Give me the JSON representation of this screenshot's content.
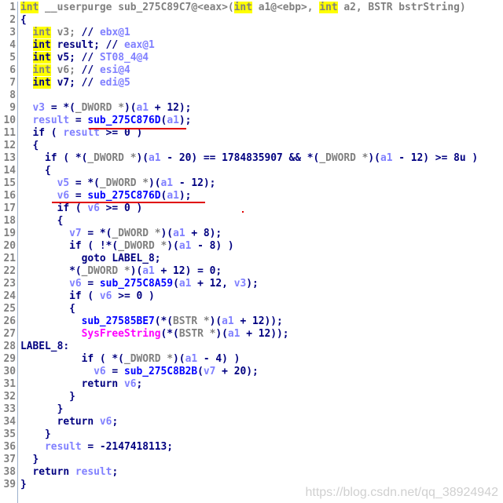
{
  "colors": {
    "keyword": "#000080",
    "type_decl": "#808080",
    "variable": "#8080ff",
    "function": "#0000ff",
    "import": "#ff00ff",
    "highlight": "#ffff00",
    "annotation": "#e00000"
  },
  "lines": [
    [
      [
        "yg",
        "int"
      ],
      [
        "g",
        " __userpurge sub_275C89C7@<eax>("
      ],
      [
        "yg",
        "int"
      ],
      [
        "g",
        " a1@<ebp>, "
      ],
      [
        "yg",
        "int"
      ],
      [
        "g",
        " a2, BSTR bstrString)"
      ]
    ],
    [
      [
        "k",
        "{"
      ]
    ],
    [
      [
        "k",
        "  "
      ],
      [
        "yg",
        "int"
      ],
      [
        "g",
        " v3; "
      ],
      [
        "k",
        "// "
      ],
      [
        "v",
        "ebx@1"
      ]
    ],
    [
      [
        "k",
        "  "
      ],
      [
        "yk",
        "int"
      ],
      [
        "k",
        " result; // "
      ],
      [
        "v",
        "eax@1"
      ]
    ],
    [
      [
        "k",
        "  "
      ],
      [
        "yk",
        "int"
      ],
      [
        "k",
        " v5; // "
      ],
      [
        "v",
        "ST08_4@4"
      ]
    ],
    [
      [
        "k",
        "  "
      ],
      [
        "yg",
        "int"
      ],
      [
        "g",
        " v6; "
      ],
      [
        "k",
        "// "
      ],
      [
        "v",
        "esi@4"
      ]
    ],
    [
      [
        "k",
        "  "
      ],
      [
        "yk",
        "int"
      ],
      [
        "k",
        " v7; // "
      ],
      [
        "v",
        "edi@5"
      ]
    ],
    [],
    [
      [
        "k",
        "  "
      ],
      [
        "v",
        "v3"
      ],
      [
        "k",
        " = *("
      ],
      [
        "g",
        "_DWORD *"
      ],
      [
        "k",
        ")("
      ],
      [
        "v",
        "a1"
      ],
      [
        "k",
        " + 12);"
      ]
    ],
    [
      [
        "k",
        "  "
      ],
      [
        "v",
        "result"
      ],
      [
        "k",
        " = "
      ],
      [
        "f",
        "sub_275C876D"
      ],
      [
        "k",
        "("
      ],
      [
        "v",
        "a1"
      ],
      [
        "k",
        ");"
      ]
    ],
    [
      [
        "k",
        "  if ( "
      ],
      [
        "v",
        "result"
      ],
      [
        "k",
        " >= 0 )"
      ]
    ],
    [
      [
        "k",
        "  {"
      ]
    ],
    [
      [
        "k",
        "    if ( *("
      ],
      [
        "g",
        "_DWORD *"
      ],
      [
        "k",
        ")("
      ],
      [
        "v",
        "a1"
      ],
      [
        "k",
        " - 20) == 1784835907 && *("
      ],
      [
        "g",
        "_DWORD *"
      ],
      [
        "k",
        ")("
      ],
      [
        "v",
        "a1"
      ],
      [
        "k",
        " - 12) >= 8u )"
      ]
    ],
    [
      [
        "k",
        "    {"
      ]
    ],
    [
      [
        "k",
        "      "
      ],
      [
        "v",
        "v5"
      ],
      [
        "k",
        " = *("
      ],
      [
        "g",
        "_DWORD *"
      ],
      [
        "k",
        ")("
      ],
      [
        "v",
        "a1"
      ],
      [
        "k",
        " - 12);"
      ]
    ],
    [
      [
        "k",
        "      "
      ],
      [
        "v",
        "v6"
      ],
      [
        "k",
        " = "
      ],
      [
        "f",
        "sub_275C876D"
      ],
      [
        "k",
        "("
      ],
      [
        "v",
        "a1"
      ],
      [
        "k",
        ");"
      ]
    ],
    [
      [
        "k",
        "      if ( "
      ],
      [
        "v",
        "v6"
      ],
      [
        "k",
        " >= 0 )"
      ]
    ],
    [
      [
        "k",
        "      {"
      ]
    ],
    [
      [
        "k",
        "        "
      ],
      [
        "v",
        "v7"
      ],
      [
        "k",
        " = *("
      ],
      [
        "g",
        "_DWORD *"
      ],
      [
        "k",
        ")("
      ],
      [
        "v",
        "a1"
      ],
      [
        "k",
        " + 8);"
      ]
    ],
    [
      [
        "k",
        "        if ( !*("
      ],
      [
        "g",
        "_DWORD *"
      ],
      [
        "k",
        ")("
      ],
      [
        "v",
        "a1"
      ],
      [
        "k",
        " - 8) )"
      ]
    ],
    [
      [
        "k",
        "          goto LABEL_8;"
      ]
    ],
    [
      [
        "k",
        "        *("
      ],
      [
        "g",
        "_DWORD *"
      ],
      [
        "k",
        ")("
      ],
      [
        "v",
        "a1"
      ],
      [
        "k",
        " + 12) = 0;"
      ]
    ],
    [
      [
        "k",
        "        "
      ],
      [
        "v",
        "v6"
      ],
      [
        "k",
        " = "
      ],
      [
        "f",
        "sub_275C8A59"
      ],
      [
        "k",
        "("
      ],
      [
        "v",
        "a1"
      ],
      [
        "k",
        " + 12, "
      ],
      [
        "v",
        "v3"
      ],
      [
        "k",
        ");"
      ]
    ],
    [
      [
        "k",
        "        if ( "
      ],
      [
        "v",
        "v6"
      ],
      [
        "k",
        " >= 0 )"
      ]
    ],
    [
      [
        "k",
        "        {"
      ]
    ],
    [
      [
        "k",
        "          "
      ],
      [
        "f",
        "sub_27585BE7"
      ],
      [
        "k",
        "(*("
      ],
      [
        "g",
        "BSTR *"
      ],
      [
        "k",
        ")("
      ],
      [
        "v",
        "a1"
      ],
      [
        "k",
        " + 12));"
      ]
    ],
    [
      [
        "k",
        "          "
      ],
      [
        "m",
        "SysFreeString"
      ],
      [
        "k",
        "(*("
      ],
      [
        "g",
        "BSTR *"
      ],
      [
        "k",
        ")("
      ],
      [
        "v",
        "a1"
      ],
      [
        "k",
        " + 12));"
      ]
    ],
    [
      [
        "k",
        "LABEL_8:"
      ]
    ],
    [
      [
        "k",
        "          if ( *("
      ],
      [
        "g",
        "_DWORD *"
      ],
      [
        "k",
        ")("
      ],
      [
        "v",
        "a1"
      ],
      [
        "k",
        " - 4) )"
      ]
    ],
    [
      [
        "k",
        "            "
      ],
      [
        "v",
        "v6"
      ],
      [
        "k",
        " = "
      ],
      [
        "f",
        "sub_275C8B2B"
      ],
      [
        "k",
        "("
      ],
      [
        "v",
        "v7"
      ],
      [
        "k",
        " + 20);"
      ]
    ],
    [
      [
        "k",
        "          return "
      ],
      [
        "v",
        "v6"
      ],
      [
        "k",
        ";"
      ]
    ],
    [
      [
        "k",
        "        }"
      ]
    ],
    [
      [
        "k",
        "      }"
      ]
    ],
    [
      [
        "k",
        "      return "
      ],
      [
        "v",
        "v6"
      ],
      [
        "k",
        ";"
      ]
    ],
    [
      [
        "k",
        "    }"
      ]
    ],
    [
      [
        "k",
        "    "
      ],
      [
        "v",
        "result"
      ],
      [
        "k",
        " = -2147418113;"
      ]
    ],
    [
      [
        "k",
        "  }"
      ]
    ],
    [
      [
        "k",
        "  return "
      ],
      [
        "v",
        "result"
      ],
      [
        "k",
        ";"
      ]
    ],
    [
      [
        "k",
        "}"
      ]
    ]
  ],
  "watermark": "https://blog.csdn.net/qq_38924942"
}
